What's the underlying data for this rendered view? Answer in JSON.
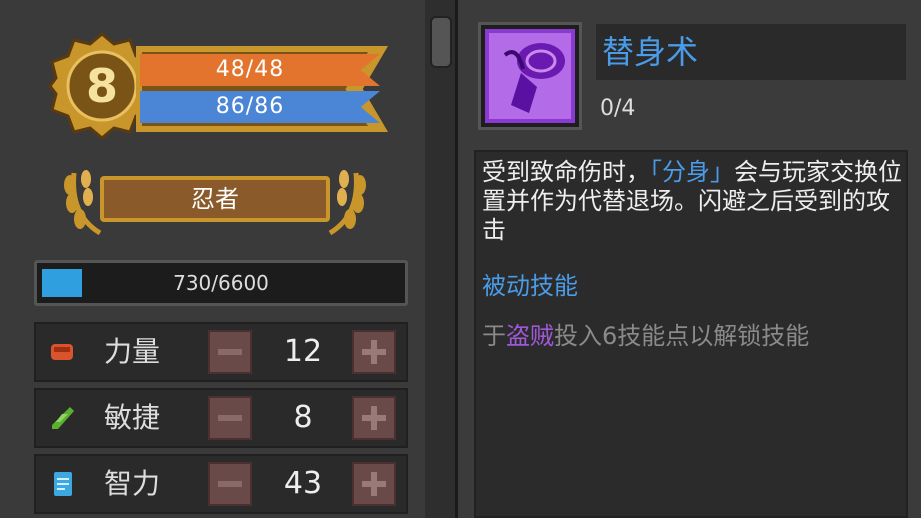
{
  "character": {
    "level": "8",
    "hp": "48/48",
    "mp": "86/86",
    "class_name": "忍者",
    "xp_text": "730/6600",
    "xp_fraction": 0.111
  },
  "stats": [
    {
      "label": "力量",
      "value": "12",
      "icon": "fist-icon",
      "color": "#d9532c"
    },
    {
      "label": "敏捷",
      "value": "8",
      "icon": "feather-icon",
      "color": "#5cb030"
    },
    {
      "label": "智力",
      "value": "43",
      "icon": "book-icon",
      "color": "#3da7e0"
    }
  ],
  "skill": {
    "name": "替身术",
    "level": "0/4",
    "desc_part1": "受到致命伤时，",
    "desc_highlight": "「分身」",
    "desc_part2": "会与玩家交换位置并作为代替退场。闪避之后受到的攻击",
    "type": "被动技能",
    "unlock_prefix": "于",
    "unlock_class": "盗贼",
    "unlock_suffix": "投入6技能点以解锁技能"
  },
  "colors": {
    "hp": "#e2742e",
    "mp": "#4b86d6",
    "gold": "#c9962c",
    "skill_title": "#4a9be8",
    "unlock_class": "#a058d8"
  }
}
